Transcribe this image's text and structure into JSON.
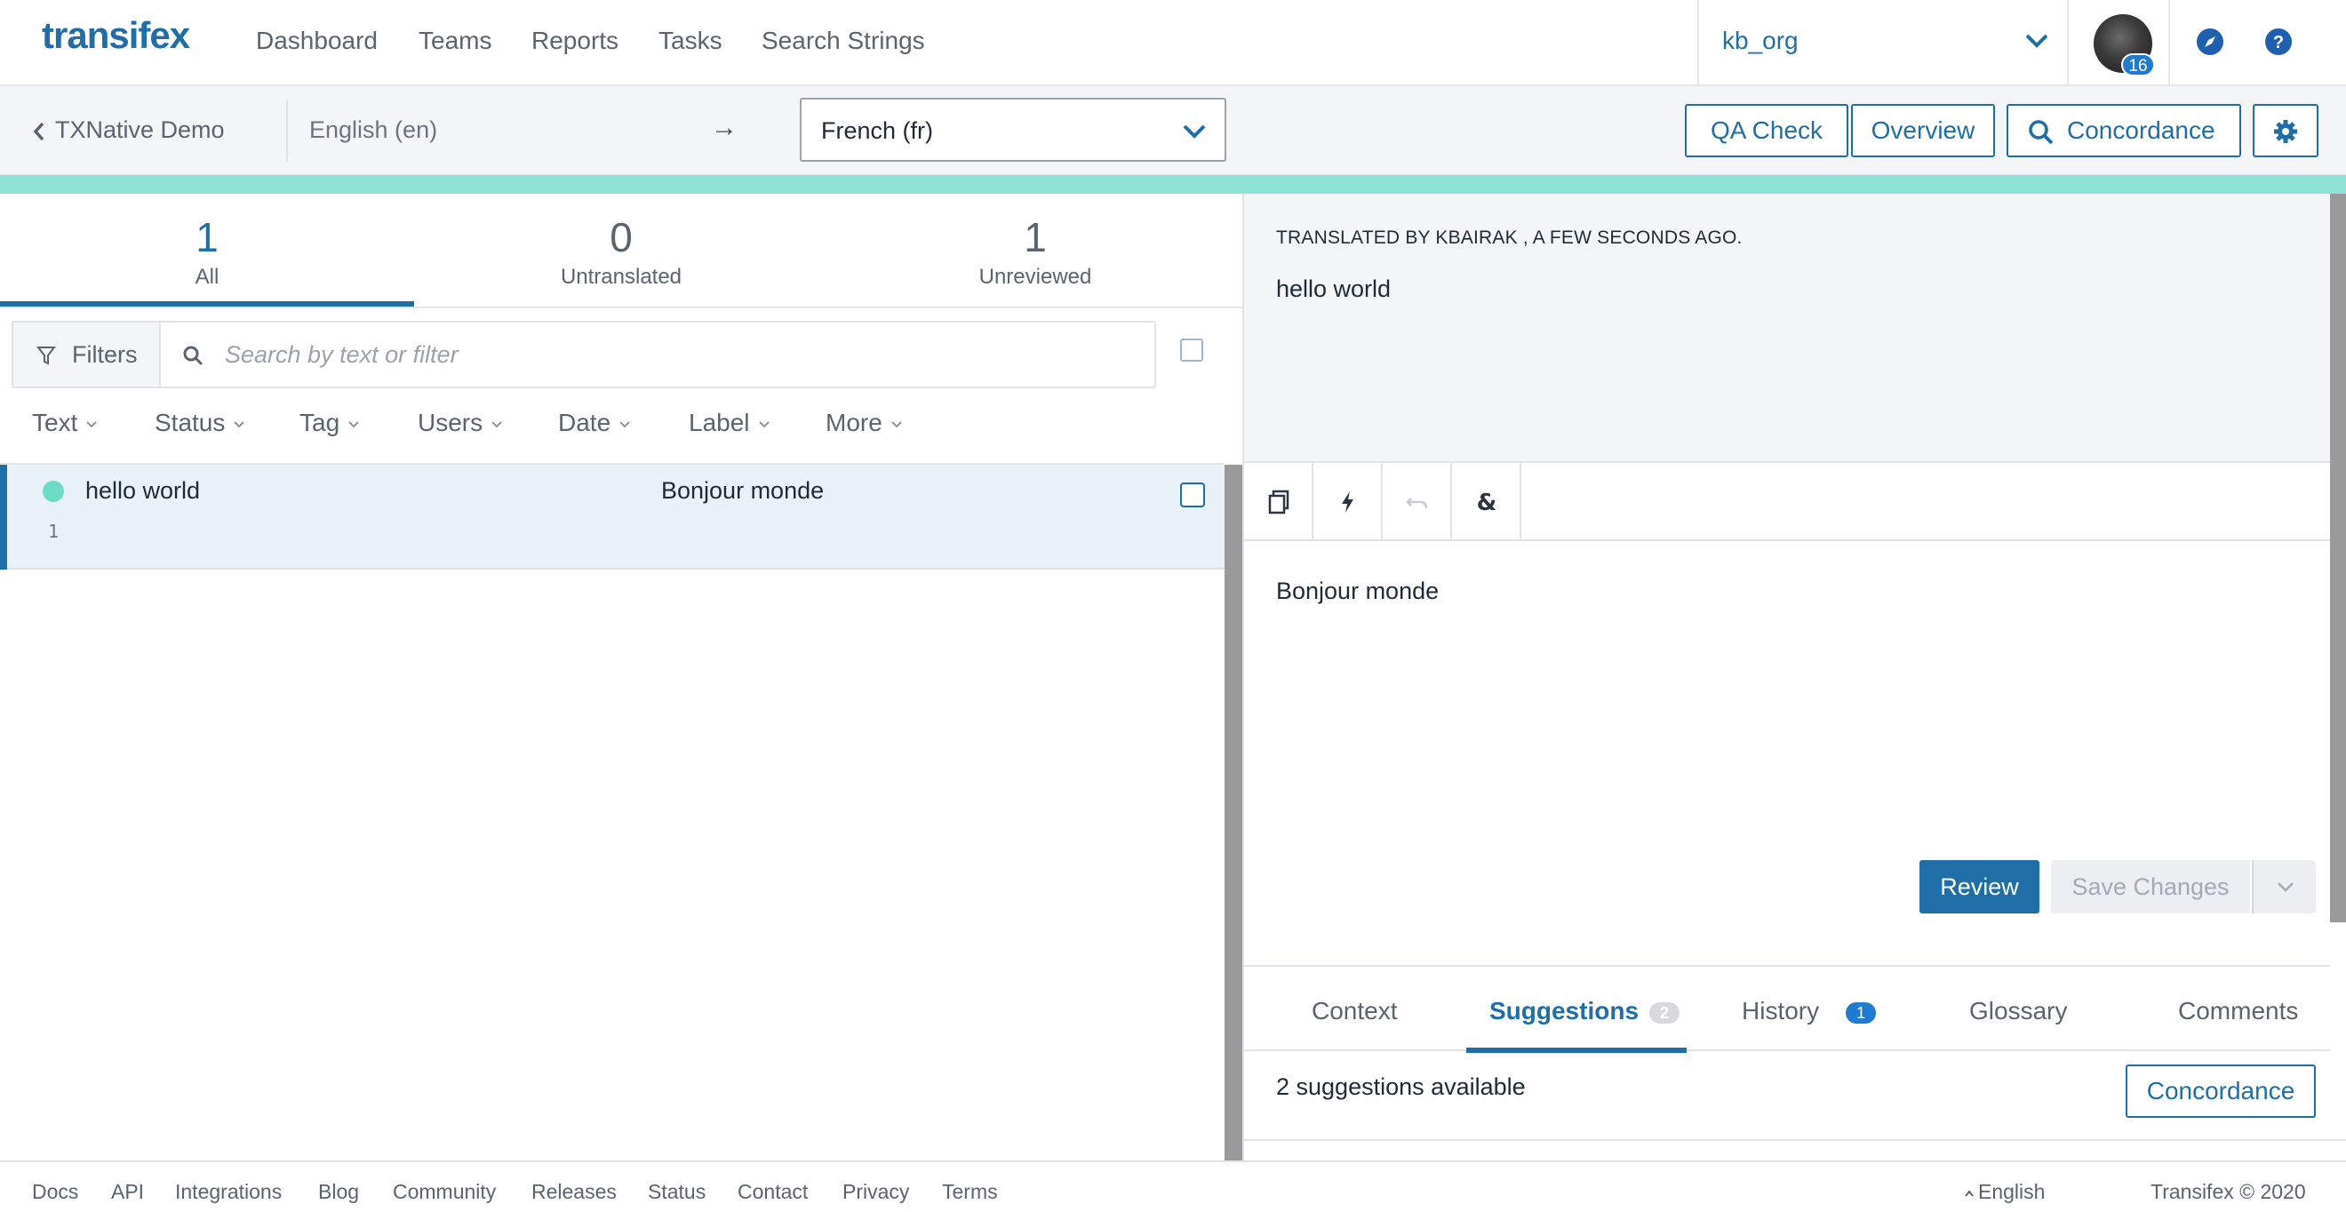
{
  "app": {
    "logo": "transifex"
  },
  "nav": {
    "links": [
      "Dashboard",
      "Teams",
      "Reports",
      "Tasks",
      "Search Strings"
    ],
    "org": "kb_org",
    "avatar_badge": "16"
  },
  "toolbar": {
    "back_label": "TXNative Demo",
    "source_lang": "English (en)",
    "arrow": "→",
    "target_lang": "French (fr)",
    "qa_check": "QA Check",
    "overview": "Overview",
    "concordance": "Concordance"
  },
  "stats": {
    "all": {
      "count": "1",
      "label": "All"
    },
    "untranslated": {
      "count": "0",
      "label": "Untranslated"
    },
    "unreviewed": {
      "count": "1",
      "label": "Unreviewed"
    }
  },
  "filters": {
    "button": "Filters",
    "search_placeholder": "Search by text or filter",
    "facets": [
      "Text",
      "Status",
      "Tag",
      "Users",
      "Date",
      "Label",
      "More"
    ]
  },
  "strings": [
    {
      "source": "hello world",
      "translation": "Bonjour monde",
      "index": "1",
      "status_color": "#6cdcc6"
    }
  ],
  "editor": {
    "meta": "TRANSLATED BY KBAIRAK , A FEW SECONDS AGO.",
    "source_text": "hello world",
    "translation_text": "Bonjour monde",
    "review_label": "Review",
    "save_label": "Save Changes",
    "tools": [
      "copy-icon",
      "lightning-icon",
      "undo-icon",
      "ampersand-icon"
    ]
  },
  "tabs": {
    "context": "Context",
    "suggestions": "Suggestions",
    "suggestions_count": "2",
    "history": "History",
    "history_count": "1",
    "glossary": "Glossary",
    "comments": "Comments"
  },
  "suggestions": {
    "summary": "2 suggestions available",
    "concordance_label": "Concordance"
  },
  "footer": {
    "links": [
      "Docs",
      "API",
      "Integrations",
      "Blog",
      "Community",
      "Releases",
      "Status",
      "Contact",
      "Privacy",
      "Terms"
    ],
    "language": "English",
    "copyright": "Transifex © 2020"
  },
  "colors": {
    "brand": "#1f6ea8",
    "progress": "#8fe3d4",
    "status_dot": "#6cdcc6"
  }
}
